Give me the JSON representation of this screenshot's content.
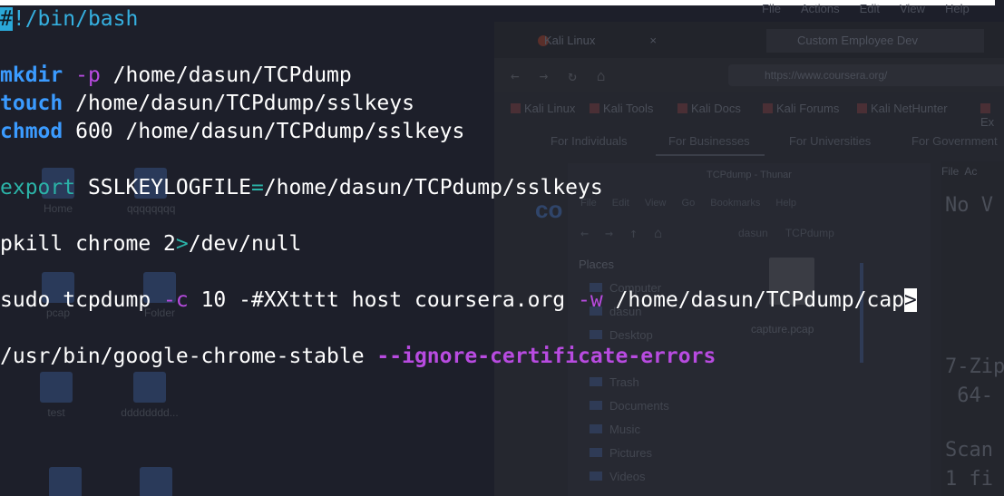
{
  "desktop": {
    "menubar": [
      "File",
      "Actions",
      "Edit",
      "View",
      "Help"
    ],
    "browser": {
      "tabs": [
        "Kali Linux",
        "Custom Employee Dev"
      ],
      "url": "https://www.coursera.org/",
      "bookmarks": [
        "Kali Linux",
        "Kali Tools",
        "Kali Docs",
        "Kali Forums",
        "Kali NetHunter",
        "Ex"
      ],
      "site_nav": [
        "For Individuals",
        "For Businesses",
        "For Universities",
        "For Government"
      ],
      "logo": "co"
    },
    "desktop_icons": [
      "Home",
      "qqqqqqqq",
      "pcap",
      "Folder",
      "test",
      "dddddddd..."
    ],
    "file_manager": {
      "title": "TCPdump - Thunar",
      "menu": [
        "File",
        "Edit",
        "View",
        "Go",
        "Bookmarks",
        "Help"
      ],
      "path": [
        "dasun",
        "TCPdump"
      ],
      "places_heading": "Places",
      "places": [
        "Computer",
        "dasun",
        "Desktop",
        "Trash",
        "Documents",
        "Music",
        "Pictures",
        "Videos"
      ],
      "file_name": "capture.pcap"
    },
    "side_window": {
      "menu": [
        "File",
        "Ac"
      ],
      "line1": "No V",
      "line2": "7-Zip",
      "line3": " 64-",
      "line4": "Scan",
      "line5": "1 fi"
    }
  },
  "terminal": {
    "shebang_cursor": "#",
    "shebang_rest": "!/bin/bash",
    "mkdir": {
      "cmd": "mkdir",
      "flag": "-p",
      "arg": " /home/dasun/TCPdump"
    },
    "touch": {
      "cmd": "touch",
      "arg": " /home/dasun/TCPdump/sslkeys"
    },
    "chmod": {
      "cmd": "chmod",
      "arg": " 600 /home/dasun/TCPdump/sslkeys"
    },
    "export": {
      "kw": "export",
      "var": " SSLKEYLOGFILE",
      "eq": "=",
      "val": "/home/dasun/TCPdump/sslkeys"
    },
    "pkill": {
      "a": "pkill chrome 2",
      "op": ">",
      "b": "/dev/null"
    },
    "tcpdump": {
      "a": "sudo tcpdump ",
      "flag1": "-c",
      "b": " 10 -#XXtttt host coursera.org ",
      "flag2": "-w",
      "c": " /home/dasun/TCPdump/cap",
      "overflow": ">"
    },
    "chrome": {
      "a": "/usr/bin/google-chrome-stable ",
      "flag": "--ignore-certificate-errors"
    }
  }
}
